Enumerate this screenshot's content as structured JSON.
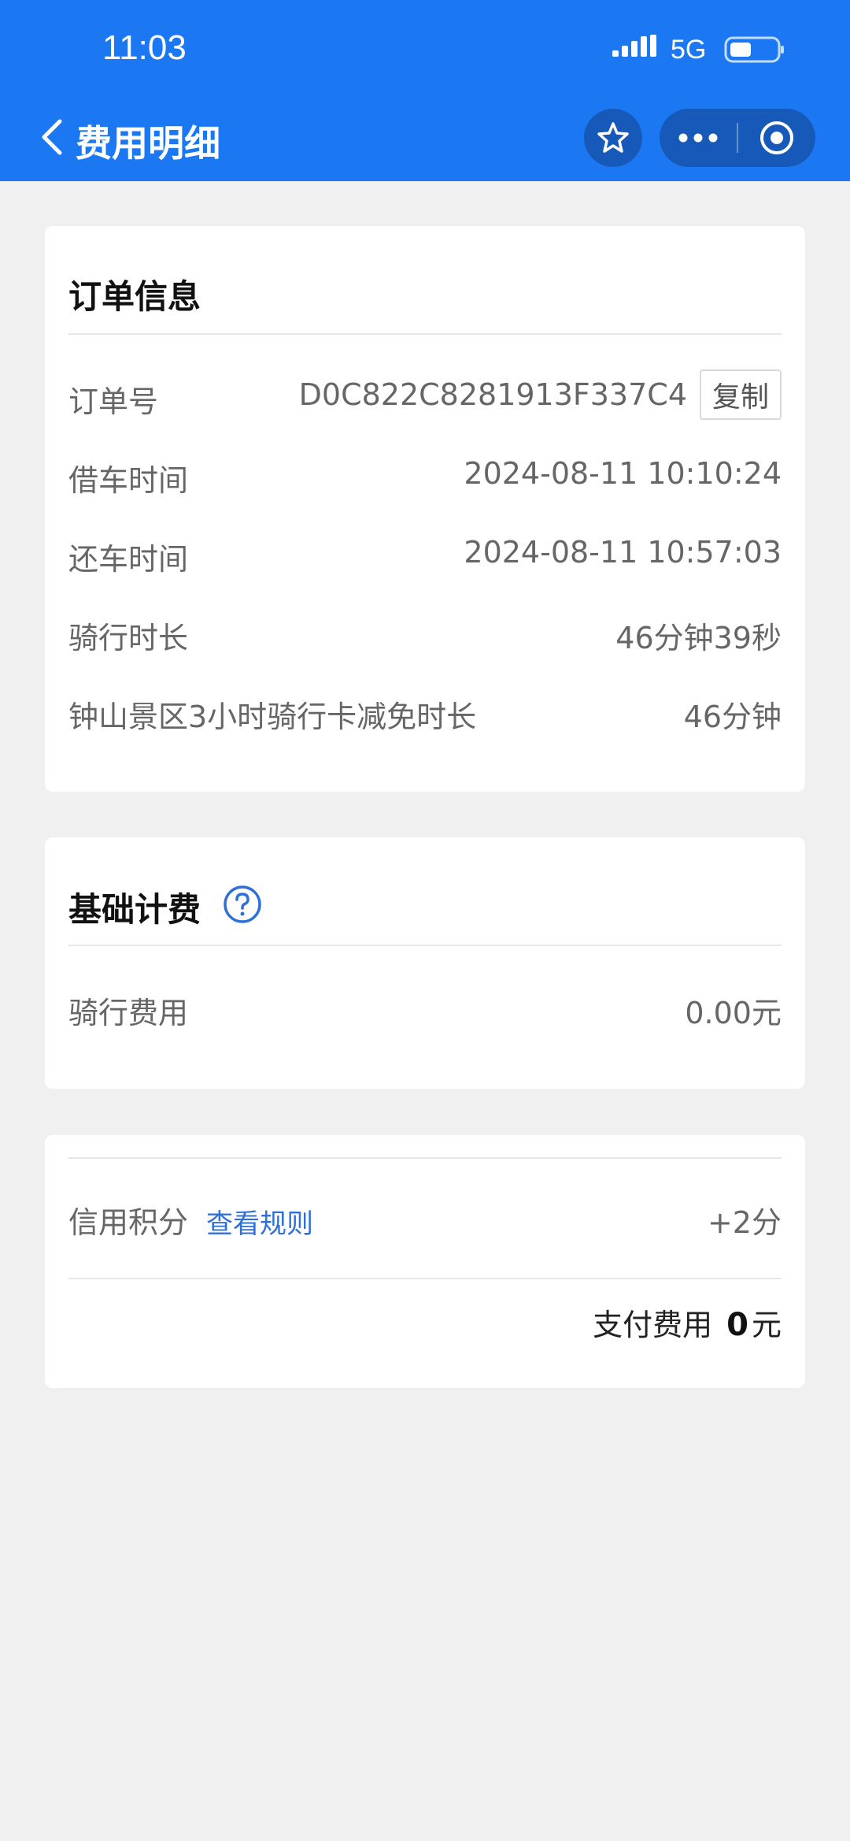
{
  "status_bar": {
    "time": "11:03",
    "network": "5G"
  },
  "nav": {
    "title": "费用明细"
  },
  "order_info": {
    "title": "订单信息",
    "copy_label": "复制",
    "rows": [
      {
        "label": "订单号",
        "value": "D0C822C8281913F337C4"
      },
      {
        "label": "借车时间",
        "value": "2024-08-11 10:10:24"
      },
      {
        "label": "还车时间",
        "value": "2024-08-11 10:57:03"
      },
      {
        "label": "骑行时长",
        "value": "46分钟39秒"
      },
      {
        "label": "钟山景区3小时骑行卡减免时长",
        "value": "46分钟"
      }
    ]
  },
  "base_fee": {
    "title": "基础计费",
    "rows": [
      {
        "label": "骑行费用",
        "value": "0.00元"
      }
    ]
  },
  "credit": {
    "label": "信用积分",
    "rule_link": "查看规则",
    "value": "+2分"
  },
  "payment": {
    "label": "支付费用",
    "amount": "0",
    "unit": "元"
  },
  "colors": {
    "header_bg": "#1b78f2",
    "capsule_bg": "#1659b8",
    "link": "#2f6fd8",
    "page_bg": "#f0f0f0"
  }
}
